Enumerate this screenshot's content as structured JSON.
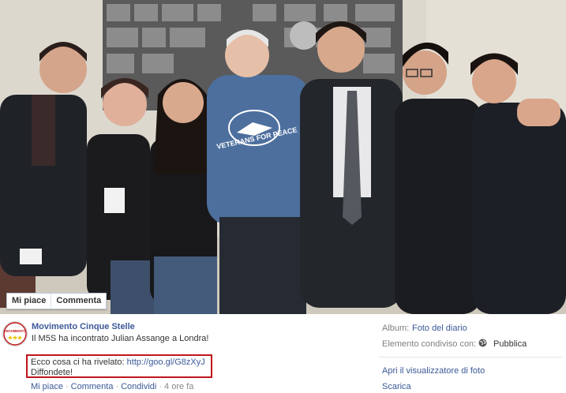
{
  "photo": {
    "like_label": "Mi piace",
    "comment_label": "Commenta",
    "sweatshirt_text": "VETERANS FOR PEACE"
  },
  "post": {
    "page_name": "Movimento Cinque Stelle",
    "line1": "Il M5S ha incontrato Julian Assange a Londra!",
    "ecco_prefix": "Ecco cosa ci ha rivelato: ",
    "link_url": "http://goo.gl/G8zXyJ",
    "diffondete": "Diffondete!",
    "actions": {
      "like": "Mi piace",
      "comment": "Commenta",
      "share": "Condividi",
      "time": "4 ore fa",
      "separator": "·"
    },
    "avatar_text": "MOVIMENTO"
  },
  "sidebar": {
    "album_label": "Album:",
    "album_value": "Foto del diario",
    "shared_label": "Elemento condiviso con:",
    "shared_value": "Pubblica",
    "open_viewer": "Apri il visualizzatore di foto",
    "download": "Scarica"
  },
  "colors": {
    "link_blue": "#3b5998",
    "highlight_red": "#c0161b"
  }
}
